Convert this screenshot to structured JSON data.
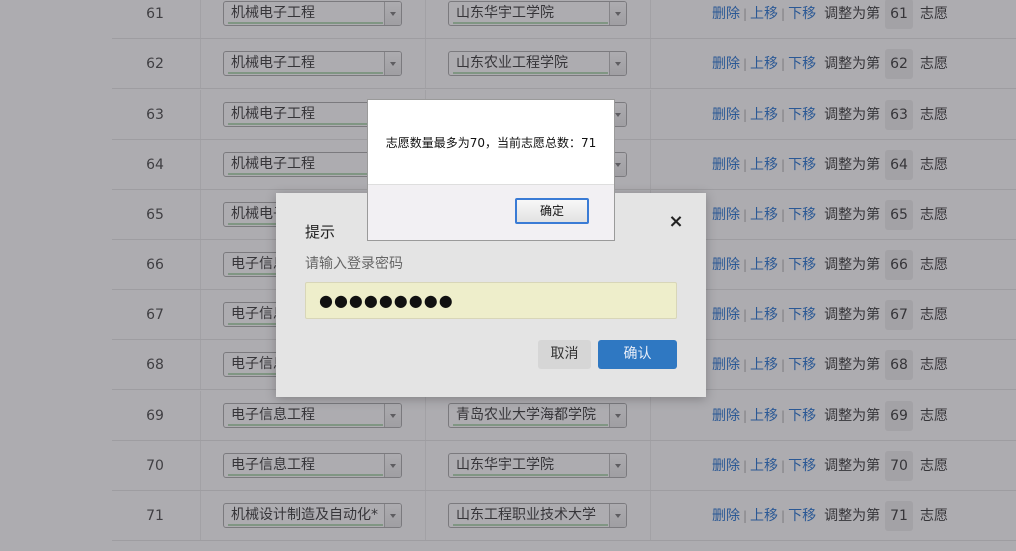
{
  "rows": [
    {
      "index": "61",
      "major": "机械电子工程",
      "school": "山东华宇工学院",
      "rank": "61"
    },
    {
      "index": "62",
      "major": "机械电子工程",
      "school": "山东农业工程学院",
      "rank": "62"
    },
    {
      "index": "63",
      "major": "机械电子工程",
      "school": "",
      "rank": "63"
    },
    {
      "index": "64",
      "major": "机械电子工程",
      "school": "",
      "rank": "64"
    },
    {
      "index": "65",
      "major": "机械电子",
      "school": "",
      "rank": "65"
    },
    {
      "index": "66",
      "major": "电子信息",
      "school": "",
      "rank": "66"
    },
    {
      "index": "67",
      "major": "电子信息",
      "school": "",
      "rank": "67"
    },
    {
      "index": "68",
      "major": "电子信息",
      "school": "",
      "rank": "68"
    },
    {
      "index": "69",
      "major": "电子信息工程",
      "school": "青岛农业大学海都学院",
      "rank": "69"
    },
    {
      "index": "70",
      "major": "电子信息工程",
      "school": "山东华宇工学院",
      "rank": "70"
    },
    {
      "index": "71",
      "major": "机械设计制造及自动化*",
      "school": "山东工程职业技术大学",
      "rank": "71"
    }
  ],
  "ops": {
    "delete": "删除",
    "up": "上移",
    "down": "下移",
    "adjust_prefix": "调整为第",
    "adjust_suffix": "志愿",
    "sep": "|"
  },
  "prompt": {
    "title": "提示",
    "close": "×",
    "hint": "请输入登录密码",
    "password_mask": "●●●●●●●●●",
    "cancel": "取消",
    "confirm": "确认"
  },
  "alert": {
    "message": "志愿数量最多为70，当前志愿总数：71",
    "ok": "确定"
  },
  "colors": {
    "link": "#1e6fd0",
    "primary_button": "#2f78c2",
    "password_field_bg": "#eeeecb",
    "overlay": "rgba(60,58,66,0.42)"
  }
}
